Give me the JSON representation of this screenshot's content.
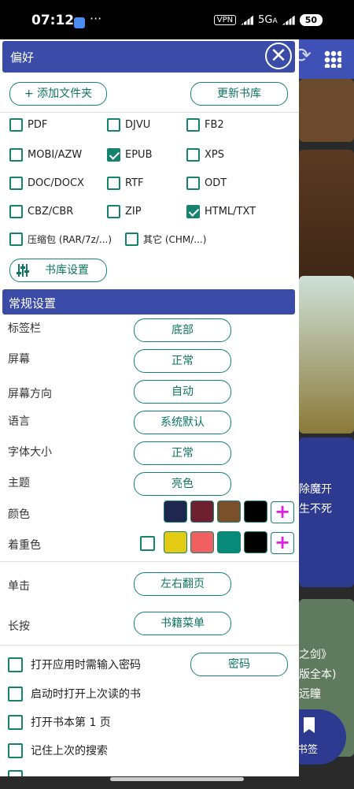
{
  "status": {
    "time": "07:12",
    "dots": "···",
    "vpn": "VPN",
    "net": "5G",
    "net_sub": "A",
    "battery": "50"
  },
  "dialog": {
    "title": "偏好",
    "close_glyph": "✕",
    "add_folder": "+ 添加文件夹",
    "update_library": "更新书库",
    "formats": [
      {
        "label": "PDF",
        "checked": false
      },
      {
        "label": "DJVU",
        "checked": false
      },
      {
        "label": "FB2",
        "checked": false
      },
      {
        "label": "MOBI/AZW",
        "checked": false
      },
      {
        "label": "EPUB",
        "checked": true
      },
      {
        "label": "XPS",
        "checked": false
      },
      {
        "label": "DOC/DOCX",
        "checked": false
      },
      {
        "label": "RTF",
        "checked": false
      },
      {
        "label": "ODT",
        "checked": false
      },
      {
        "label": "CBZ/CBR",
        "checked": false
      },
      {
        "label": "ZIP",
        "checked": false
      },
      {
        "label": "HTML/TXT",
        "checked": true
      },
      {
        "label": "压缩包 (RAR/7z/...)",
        "checked": false
      },
      {
        "label": "其它 (CHM/...)",
        "checked": false
      }
    ],
    "library_settings": "书库设置",
    "general_section": "常规设置",
    "settings": [
      {
        "label": "标签栏",
        "value": "底部"
      },
      {
        "label": "屏幕",
        "value": "正常"
      },
      {
        "label": "屏幕方向",
        "value": "自动"
      },
      {
        "label": "语言",
        "value": "系统默认"
      },
      {
        "label": "字体大小",
        "value": "正常"
      },
      {
        "label": "主题",
        "value": "亮色"
      }
    ],
    "color_label": "颜色",
    "accent_label": "着重色",
    "colors": [
      "#1d2750",
      "#6e2030",
      "#7a4f2c",
      "#000000"
    ],
    "accents": [
      "#e3cb13",
      "#f06060",
      "#0a8a78",
      "#000000"
    ],
    "plus_glyph": "+",
    "single_tap_label": "单击",
    "single_tap_value": "左右翻页",
    "long_press_label": "长按",
    "long_press_value": "书籍菜单",
    "options": [
      {
        "label": "打开应用时需输入密码",
        "checked": false
      },
      {
        "label": "启动时打开上次读的书",
        "checked": false
      },
      {
        "label": "打开书本第 1 页",
        "checked": false
      },
      {
        "label": "记住上次的搜索",
        "checked": false
      }
    ],
    "password_button": "密码"
  },
  "background": {
    "tile_text_1": "除魔开",
    "tile_text_2": "生不死",
    "tile_text_3": "之剑》",
    "tile_text_4": "版全本)",
    "tile_text_5": "远瞳",
    "bookmark_label": "书签"
  }
}
